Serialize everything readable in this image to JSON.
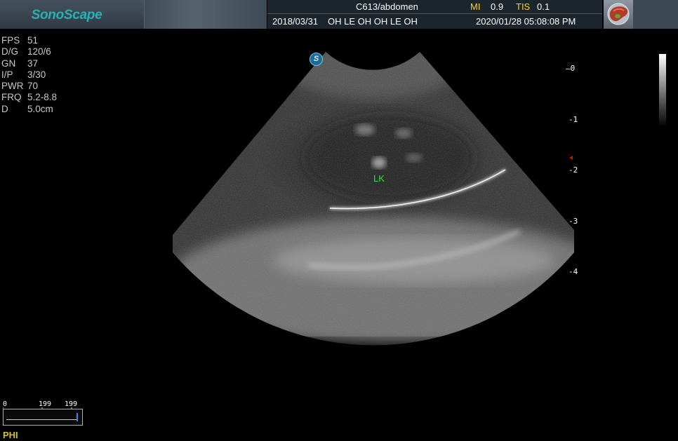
{
  "header": {
    "logo": "SonoScape",
    "probe_preset": "C613/abdomen",
    "mi_label": "MI",
    "mi_value": "0.9",
    "tis_label": "TIS",
    "tis_value": "0.1",
    "exam_date": "2018/03/31",
    "patient_text": "OH LE OH OH LE OH",
    "current_datetime": "2020/01/28 05:08:08 PM",
    "organ_icon": "liver-organ-icon"
  },
  "params": [
    {
      "key": "FPS",
      "value": "51"
    },
    {
      "key": "D/G",
      "value": "120/6"
    },
    {
      "key": "GN",
      "value": "37"
    },
    {
      "key": "I/P",
      "value": "3/30"
    },
    {
      "key": "PWR",
      "value": "70"
    },
    {
      "key": "FRQ",
      "value": "5.2-8.8"
    },
    {
      "key": "D",
      "value": "5.0cm"
    }
  ],
  "image": {
    "annotation": "LK",
    "orientation_marker": "S"
  },
  "depth_scale": [
    "0",
    "-1",
    "-2",
    "-3",
    "-4"
  ],
  "cine": {
    "start": "0",
    "current": "199",
    "total": "199"
  },
  "bottom_label": "PHI",
  "colors": {
    "accent_yellow": "#ffd21e",
    "annotation_green": "#38e038",
    "logo_teal": "#2ab0b4",
    "focus_red": "#d01010"
  }
}
